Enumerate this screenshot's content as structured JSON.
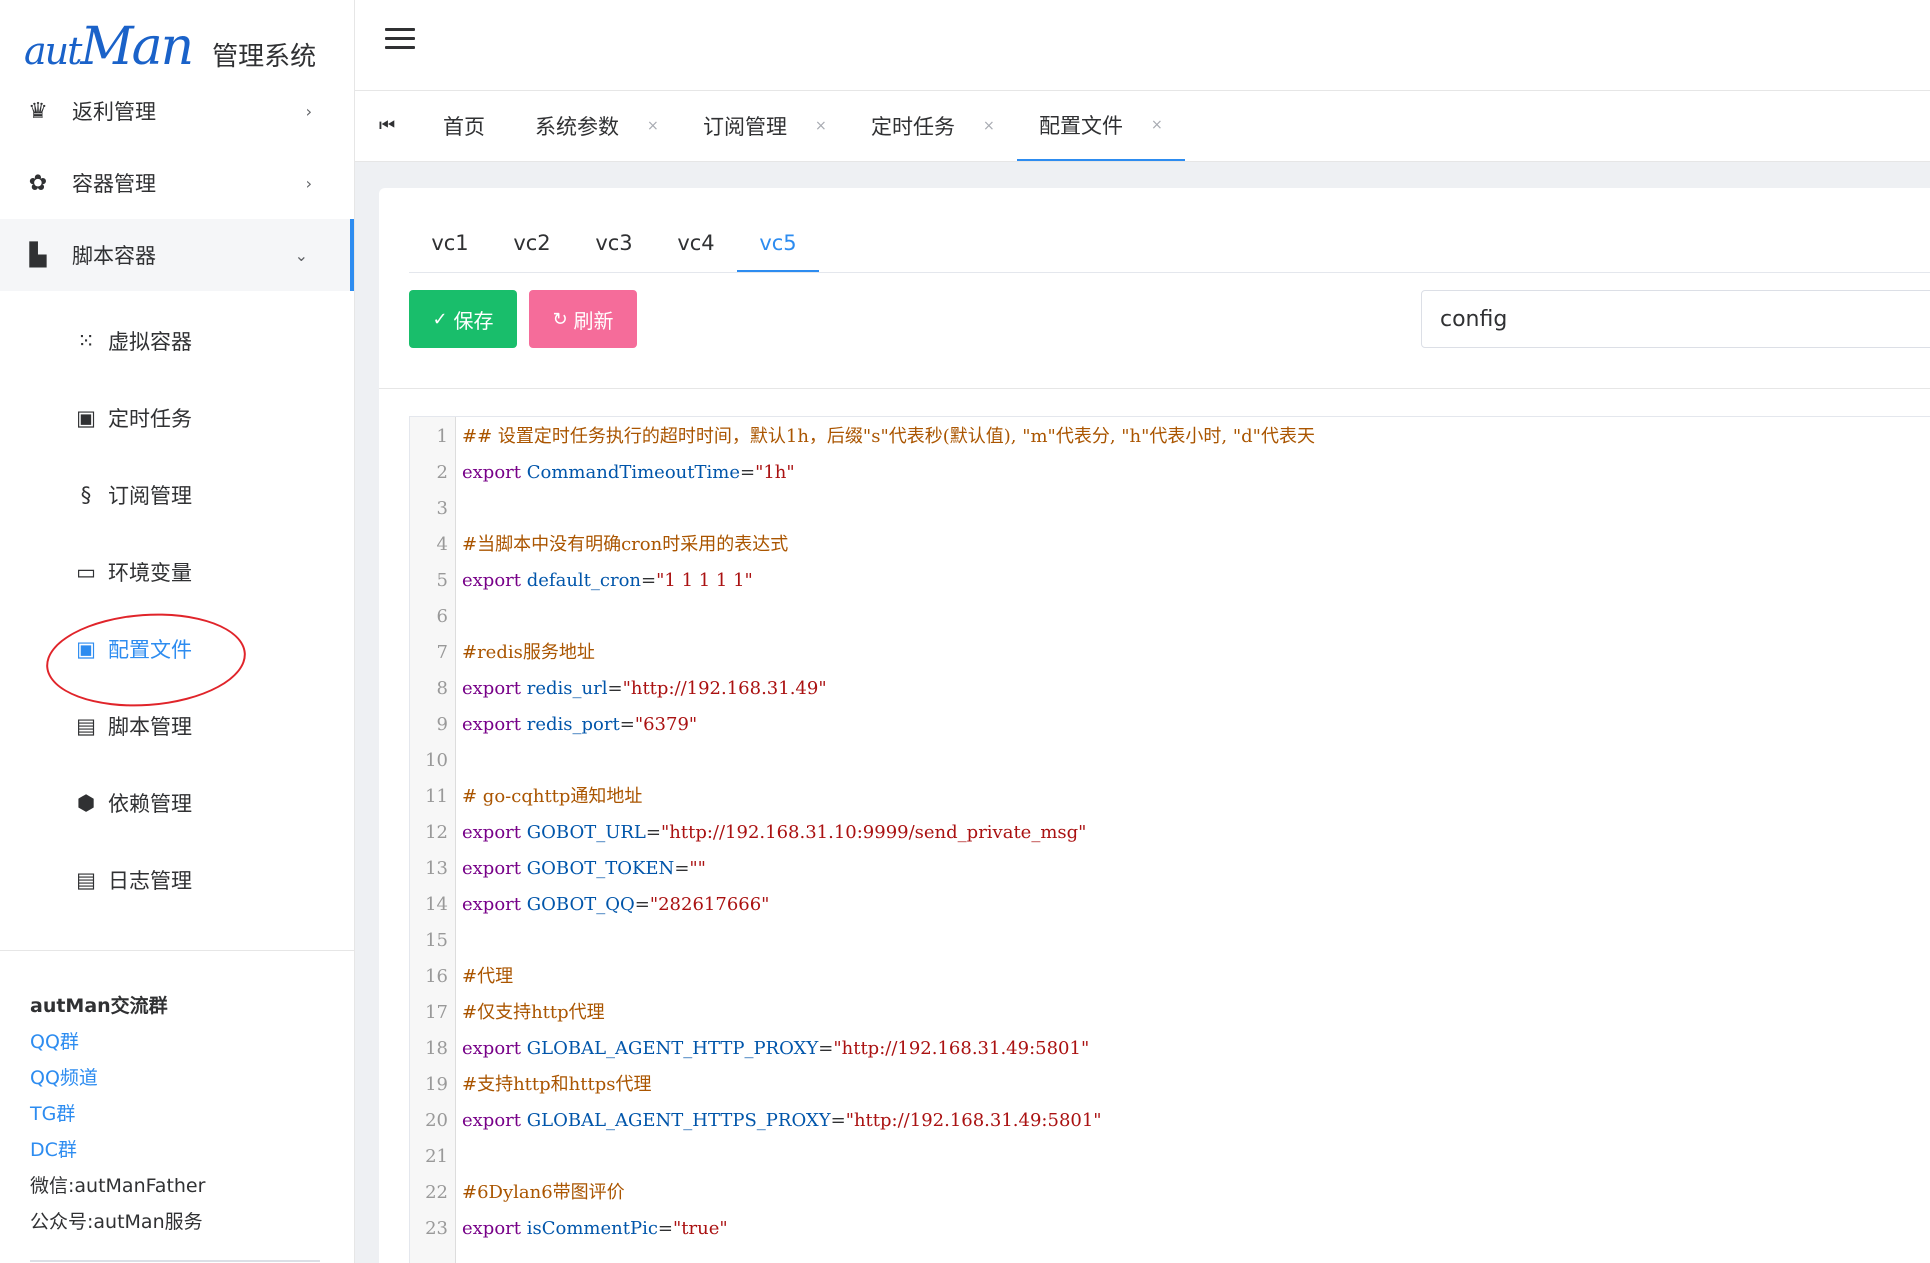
{
  "app": {
    "brand": "autMan",
    "system_title": "管理系统"
  },
  "sidebar": {
    "menus": [
      {
        "label": "返利管理",
        "icon": "crown-icon",
        "arrow": "›"
      },
      {
        "label": "容器管理",
        "icon": "palette-icon",
        "arrow": "›"
      },
      {
        "label": "脚本容器",
        "icon": "dashboard-icon",
        "arrow": "⌄"
      }
    ],
    "submenus": [
      {
        "label": "虚拟容器",
        "icon": "dots-grid-icon"
      },
      {
        "label": "定时任务",
        "icon": "calendar-clock-icon"
      },
      {
        "label": "订阅管理",
        "icon": "section-icon"
      },
      {
        "label": "环境变量",
        "icon": "monitor-icon"
      },
      {
        "label": "配置文件",
        "icon": "config-icon"
      },
      {
        "label": "脚本管理",
        "icon": "script-book-icon"
      },
      {
        "label": "依赖管理",
        "icon": "dependency-icon"
      },
      {
        "label": "日志管理",
        "icon": "log-file-icon"
      }
    ],
    "active_submenu": "配置文件",
    "community": {
      "title": "autMan交流群",
      "links": [
        "QQ群",
        "QQ频道",
        "TG群",
        "DC群"
      ],
      "texts": [
        "微信:autManFather",
        "公众号:autMan服务"
      ]
    }
  },
  "tabbar": {
    "tabs": [
      {
        "label": "首页",
        "closable": false
      },
      {
        "label": "系统参数",
        "closable": true,
        "close": "×"
      },
      {
        "label": "订阅管理",
        "closable": true,
        "close": "×"
      },
      {
        "label": "定时任务",
        "closable": true,
        "close": "×"
      },
      {
        "label": "配置文件",
        "closable": true,
        "close": "×"
      }
    ],
    "active_tab": "配置文件"
  },
  "content": {
    "subtabs": [
      "vc1",
      "vc2",
      "vc3",
      "vc4",
      "vc5"
    ],
    "active_subtab": "vc5",
    "save_label": "保存",
    "refresh_label": "刷新",
    "file_selected": "config",
    "colors": {
      "save": "#19be6b",
      "refresh": "#f56c9a",
      "accent": "#2d8cf0"
    }
  },
  "editor": {
    "lines": [
      {
        "n": "1",
        "type": "comment",
        "text": "## 设置定时任务执行的超时时间，默认1h，后缀\"s\"代表秒(默认值), \"m\"代表分, \"h\"代表小时, \"d\"代表天"
      },
      {
        "n": "2",
        "type": "export",
        "name": "CommandTimeoutTime",
        "value": "\"1h\""
      },
      {
        "n": "3",
        "type": "blank"
      },
      {
        "n": "4",
        "type": "comment",
        "text": "#当脚本中没有明确cron时采用的表达式"
      },
      {
        "n": "5",
        "type": "export",
        "name": "default_cron",
        "value": "\"1 1 1 1 1\""
      },
      {
        "n": "6",
        "type": "blank"
      },
      {
        "n": "7",
        "type": "comment",
        "text": "#redis服务地址"
      },
      {
        "n": "8",
        "type": "export",
        "name": "redis_url",
        "value": "\"http://192.168.31.49\""
      },
      {
        "n": "9",
        "type": "export",
        "name": "redis_port",
        "value": "\"6379\""
      },
      {
        "n": "10",
        "type": "blank"
      },
      {
        "n": "11",
        "type": "comment",
        "text": "# go-cqhttp通知地址"
      },
      {
        "n": "12",
        "type": "export",
        "name": "GOBOT_URL",
        "value": "\"http://192.168.31.10:9999/send_private_msg\""
      },
      {
        "n": "13",
        "type": "export",
        "name": "GOBOT_TOKEN",
        "value": "\"\""
      },
      {
        "n": "14",
        "type": "export",
        "name": "GOBOT_QQ",
        "value": "\"282617666\""
      },
      {
        "n": "15",
        "type": "blank"
      },
      {
        "n": "16",
        "type": "comment",
        "text": "#代理"
      },
      {
        "n": "17",
        "type": "comment",
        "text": "#仅支持http代理"
      },
      {
        "n": "18",
        "type": "export",
        "name": "GLOBAL_AGENT_HTTP_PROXY",
        "value": "\"http://192.168.31.49:5801\""
      },
      {
        "n": "19",
        "type": "comment",
        "text": "#支持http和https代理"
      },
      {
        "n": "20",
        "type": "export",
        "name": "GLOBAL_AGENT_HTTPS_PROXY",
        "value": "\"http://192.168.31.49:5801\""
      },
      {
        "n": "21",
        "type": "blank"
      },
      {
        "n": "22",
        "type": "comment",
        "text": "#6Dylan6带图评价"
      },
      {
        "n": "23",
        "type": "export",
        "name": "isCommentPic",
        "value": "\"true\""
      }
    ],
    "keyword": "export"
  }
}
